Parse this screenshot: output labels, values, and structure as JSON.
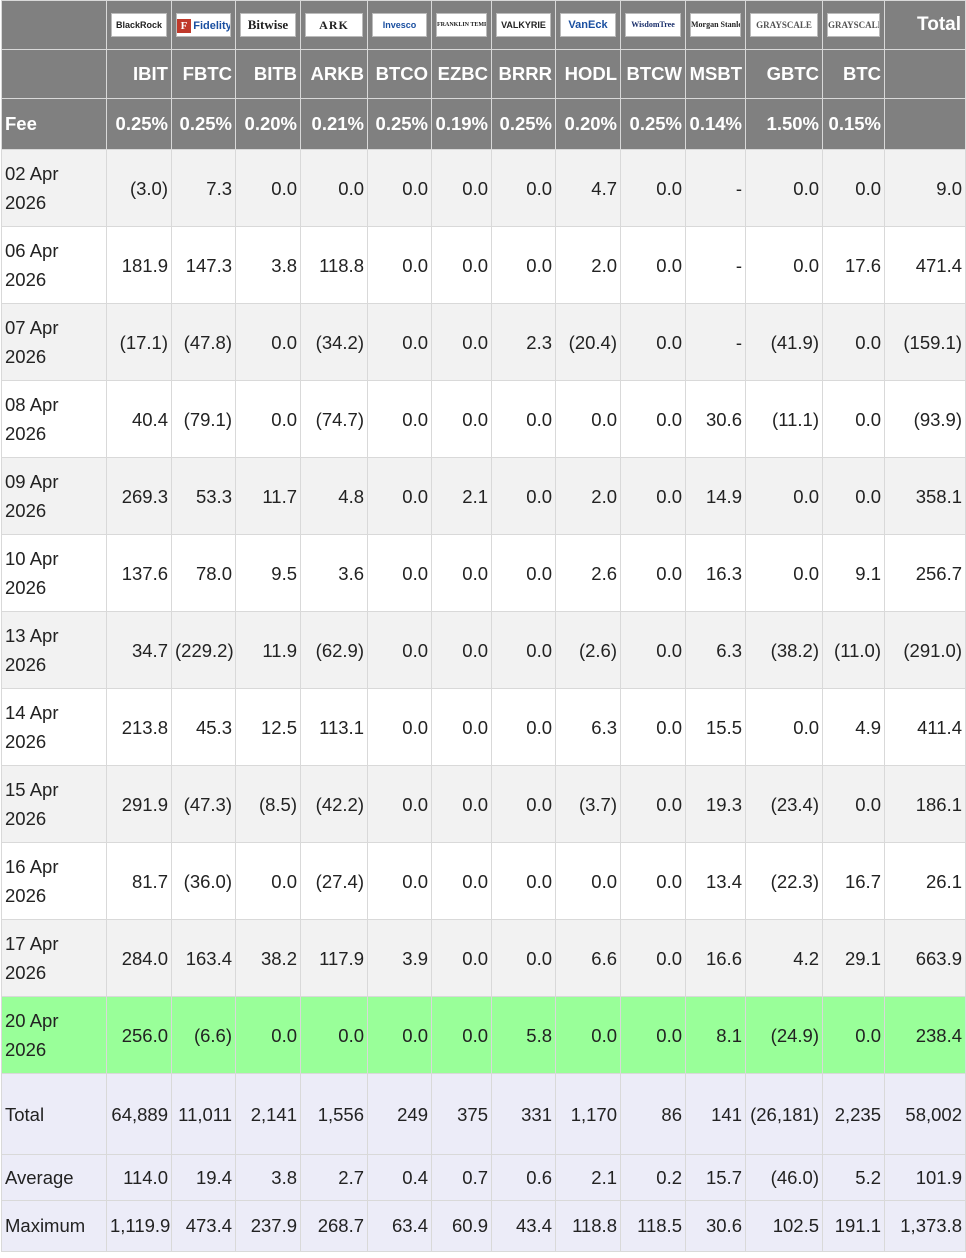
{
  "providers": [
    {
      "logo": "BlackRock",
      "ticker": "IBIT",
      "fee": "0.25%"
    },
    {
      "logo": "Fidelity",
      "ticker": "FBTC",
      "fee": "0.25%"
    },
    {
      "logo": "Bitwise",
      "ticker": "BITB",
      "fee": "0.20%"
    },
    {
      "logo": "ARK",
      "ticker": "ARKB",
      "fee": "0.21%"
    },
    {
      "logo": "Invesco",
      "ticker": "BTCO",
      "fee": "0.25%"
    },
    {
      "logo": "FRANKLIN TEMPLETON",
      "ticker": "EZBC",
      "fee": "0.19%"
    },
    {
      "logo": "VALKYRIE",
      "ticker": "BRRR",
      "fee": "0.25%"
    },
    {
      "logo": "VanEck",
      "ticker": "HODL",
      "fee": "0.20%"
    },
    {
      "logo": "WisdomTree",
      "ticker": "BTCW",
      "fee": "0.25%"
    },
    {
      "logo": "Morgan Stanley",
      "ticker": "MSBT",
      "fee": "0.14%"
    },
    {
      "logo": "GRAYSCALE",
      "ticker": "GBTC",
      "fee": "1.50%"
    },
    {
      "logo": "GRAYSCALE",
      "ticker": "BTC",
      "fee": "0.15%"
    }
  ],
  "header": {
    "total_label": "Total",
    "fee_label": "Fee"
  },
  "rows": [
    {
      "date": "02 Apr 2026",
      "cells": [
        "(3.0)",
        "7.3",
        "0.0",
        "0.0",
        "0.0",
        "0.0",
        "0.0",
        "4.7",
        "0.0",
        "-",
        "0.0",
        "0.0",
        "9.0"
      ]
    },
    {
      "date": "06 Apr 2026",
      "cells": [
        "181.9",
        "147.3",
        "3.8",
        "118.8",
        "0.0",
        "0.0",
        "0.0",
        "2.0",
        "0.0",
        "-",
        "0.0",
        "17.6",
        "471.4"
      ]
    },
    {
      "date": "07 Apr 2026",
      "cells": [
        "(17.1)",
        "(47.8)",
        "0.0",
        "(34.2)",
        "0.0",
        "0.0",
        "2.3",
        "(20.4)",
        "0.0",
        "-",
        "(41.9)",
        "0.0",
        "(159.1)"
      ]
    },
    {
      "date": "08 Apr 2026",
      "cells": [
        "40.4",
        "(79.1)",
        "0.0",
        "(74.7)",
        "0.0",
        "0.0",
        "0.0",
        "0.0",
        "0.0",
        "30.6",
        "(11.1)",
        "0.0",
        "(93.9)"
      ]
    },
    {
      "date": "09 Apr 2026",
      "cells": [
        "269.3",
        "53.3",
        "11.7",
        "4.8",
        "0.0",
        "2.1",
        "0.0",
        "2.0",
        "0.0",
        "14.9",
        "0.0",
        "0.0",
        "358.1"
      ]
    },
    {
      "date": "10 Apr 2026",
      "cells": [
        "137.6",
        "78.0",
        "9.5",
        "3.6",
        "0.0",
        "0.0",
        "0.0",
        "2.6",
        "0.0",
        "16.3",
        "0.0",
        "9.1",
        "256.7"
      ]
    },
    {
      "date": "13 Apr 2026",
      "cells": [
        "34.7",
        "(229.2)",
        "11.9",
        "(62.9)",
        "0.0",
        "0.0",
        "0.0",
        "(2.6)",
        "0.0",
        "6.3",
        "(38.2)",
        "(11.0)",
        "(291.0)"
      ]
    },
    {
      "date": "14 Apr 2026",
      "cells": [
        "213.8",
        "45.3",
        "12.5",
        "113.1",
        "0.0",
        "0.0",
        "0.0",
        "6.3",
        "0.0",
        "15.5",
        "0.0",
        "4.9",
        "411.4"
      ]
    },
    {
      "date": "15 Apr 2026",
      "cells": [
        "291.9",
        "(47.3)",
        "(8.5)",
        "(42.2)",
        "0.0",
        "0.0",
        "0.0",
        "(3.7)",
        "0.0",
        "19.3",
        "(23.4)",
        "0.0",
        "186.1"
      ]
    },
    {
      "date": "16 Apr 2026",
      "cells": [
        "81.7",
        "(36.0)",
        "0.0",
        "(27.4)",
        "0.0",
        "0.0",
        "0.0",
        "0.0",
        "0.0",
        "13.4",
        "(22.3)",
        "16.7",
        "26.1"
      ]
    },
    {
      "date": "17 Apr 2026",
      "cells": [
        "284.0",
        "163.4",
        "38.2",
        "117.9",
        "3.9",
        "0.0",
        "0.0",
        "6.6",
        "0.0",
        "16.6",
        "4.2",
        "29.1",
        "663.9"
      ]
    },
    {
      "date": "20 Apr 2026",
      "cells": [
        "256.0",
        "(6.6)",
        "0.0",
        "0.0",
        "0.0",
        "0.0",
        "5.8",
        "0.0",
        "0.0",
        "8.1",
        "(24.9)",
        "0.0",
        "238.4"
      ],
      "highlight": true
    }
  ],
  "summary": [
    {
      "label": "Total",
      "cells": [
        "64,889",
        "11,011",
        "2,141",
        "1,556",
        "249",
        "375",
        "331",
        "1,170",
        "86",
        "141",
        "(26,181)",
        "2,235",
        "58,002"
      ]
    },
    {
      "label": "Average",
      "cells": [
        "114.0",
        "19.4",
        "3.8",
        "2.7",
        "0.4",
        "0.7",
        "0.6",
        "2.1",
        "0.2",
        "15.7",
        "(46.0)",
        "5.2",
        "101.9"
      ]
    },
    {
      "label": "Maximum",
      "cells": [
        "1,119.9",
        "473.4",
        "237.9",
        "268.7",
        "63.4",
        "60.9",
        "43.4",
        "118.8",
        "118.5",
        "30.6",
        "102.5",
        "191.1",
        "1,373.8"
      ]
    }
  ],
  "colors": {
    "header_bg": "#808080",
    "negative": "#e0261b",
    "highlight": "#99ff99",
    "summary_bg": "#ececf8",
    "stripe": "#f2f2f2"
  }
}
